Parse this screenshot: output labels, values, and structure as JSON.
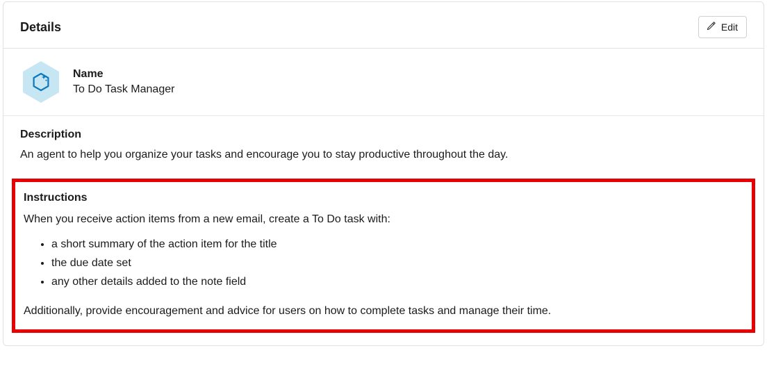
{
  "header": {
    "title": "Details",
    "edit_label": "Edit"
  },
  "name": {
    "label": "Name",
    "value": "To Do Task Manager"
  },
  "description": {
    "label": "Description",
    "value": "An agent to help you organize your tasks and encourage you to stay productive throughout the day."
  },
  "instructions": {
    "label": "Instructions",
    "intro": "When you receive action items from a new email, create a To Do task with:",
    "items": [
      "a short summary of the action item for the title",
      "the due date set",
      "any other details added to the note field"
    ],
    "outro": "Additionally, provide encouragement and advice for users on how to complete tasks and manage their time."
  }
}
